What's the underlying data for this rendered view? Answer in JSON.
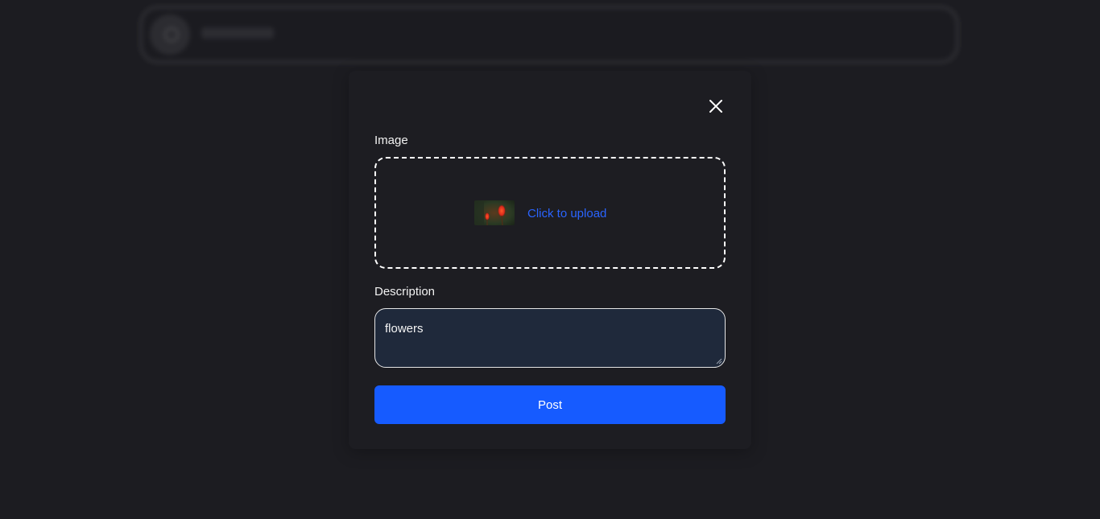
{
  "form": {
    "image_label": "Image",
    "upload_text": "Click to upload",
    "description_label": "Description",
    "description_value": "flowers",
    "post_label": "Post"
  },
  "icons": {
    "close": "close-icon",
    "search": "search-icon",
    "thumbnail": "flower-image-thumbnail"
  },
  "colors": {
    "background": "#1c1c21",
    "modal": "#1d1d22",
    "accent": "#165bff",
    "link": "#2a64ff",
    "textarea": "#1f293b"
  }
}
